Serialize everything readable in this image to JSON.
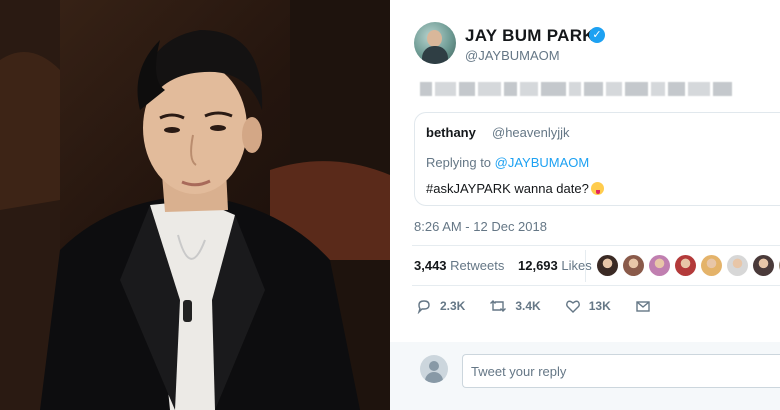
{
  "tweet": {
    "display_name": "JAY BUM PARK",
    "handle": "@JAYBUMAOM",
    "verified_icon": "verified-badge-icon",
    "quote": {
      "name": "bethany",
      "handle": "@heavenlyjjk",
      "replying_prefix": "Replying to ",
      "replying_to": "@JAYBUMAOM",
      "text": "#askJAYPARK wanna date?",
      "emoji": "tongue-wink-emoji"
    },
    "timestamp": "8:26 AM - 12 Dec 2018",
    "stats": {
      "retweets_count": "3,443",
      "retweets_label": "Retweets",
      "likes_count": "12,693",
      "likes_label": "Likes"
    },
    "liker_colors": [
      "#3a2a24",
      "#8a5a4a",
      "#c07fb0",
      "#b33a3a",
      "#e4b36a",
      "#d7d7d7",
      "#4a3a3a",
      "#9a8a7a"
    ],
    "actions": {
      "reply": "2.3K",
      "retweet": "3.4K",
      "like": "13K"
    },
    "reply_placeholder": "Tweet your reply"
  },
  "colors": {
    "accent": "#1da1f2",
    "muted": "#657786"
  }
}
